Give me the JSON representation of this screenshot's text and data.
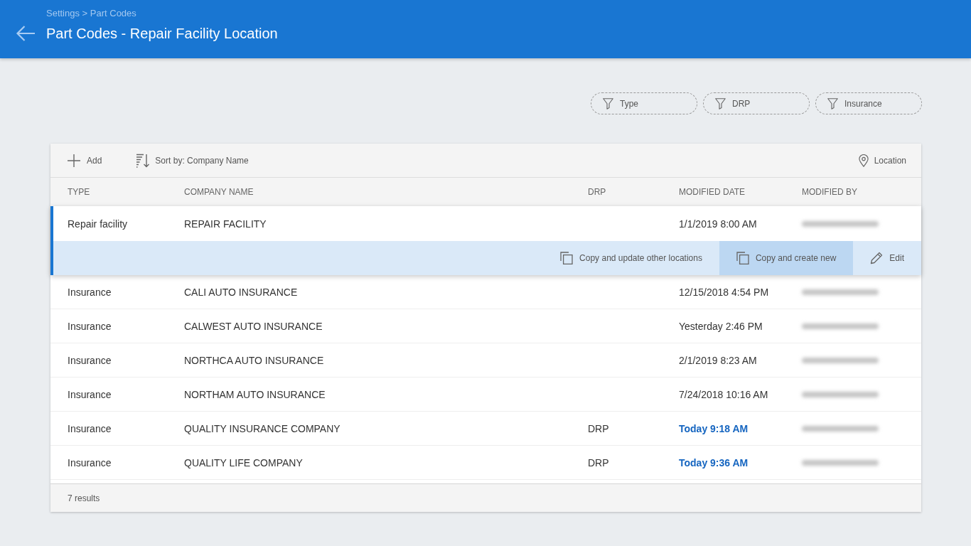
{
  "header": {
    "breadcrumb": "Settings > Part Codes",
    "title": "Part Codes - Repair Facility Location"
  },
  "filters": [
    {
      "label": "Type"
    },
    {
      "label": "DRP"
    },
    {
      "label": "Insurance"
    }
  ],
  "toolbar": {
    "add": "Add",
    "sort": "Sort by: Company Name",
    "location": "Location"
  },
  "table": {
    "columns": [
      "TYPE",
      "COMPANY NAME",
      "DRP",
      "MODIFIED DATE",
      "MODIFIED BY"
    ],
    "rows": [
      {
        "type": "Repair facility",
        "company": "REPAIR FACILITY",
        "modified_date": "1/1/2019 8:00 AM",
        "recent": false,
        "selected": true
      },
      {
        "type": "Insurance",
        "company": "CALI AUTO INSURANCE",
        "modified_date": "12/15/2018 4:54 PM",
        "recent": false,
        "selected": false
      },
      {
        "type": "Insurance",
        "company": "CALWEST AUTO INSURANCE",
        "modified_date": "Yesterday 2:46 PM",
        "recent": false,
        "selected": false
      },
      {
        "type": "Insurance",
        "company": "NORTHCA AUTO INSURANCE",
        "modified_date": "2/1/2019 8:23 AM",
        "recent": false,
        "selected": false
      },
      {
        "type": "Insurance",
        "company": "NORTHAM AUTO INSURANCE",
        "modified_date": "7/24/2018 10:16 AM",
        "recent": false,
        "selected": false
      },
      {
        "type": "Insurance",
        "company": "QUALITY INSURANCE COMPANY",
        "drp": "DRP",
        "modified_date": "Today 9:18 AM",
        "recent": true,
        "selected": false
      },
      {
        "type": "Insurance",
        "company": "QUALITY LIFE COMPANY",
        "drp": "DRP",
        "modified_date": "Today 9:36 AM",
        "recent": true,
        "selected": false
      }
    ],
    "row_actions": [
      {
        "kind": "copy",
        "label": "Copy and update other locations",
        "hovered": false
      },
      {
        "kind": "copy",
        "label": "Copy and create new",
        "hovered": true
      },
      {
        "kind": "edit",
        "label": "Edit",
        "hovered": false
      }
    ]
  },
  "footer": {
    "results": "7 results"
  }
}
